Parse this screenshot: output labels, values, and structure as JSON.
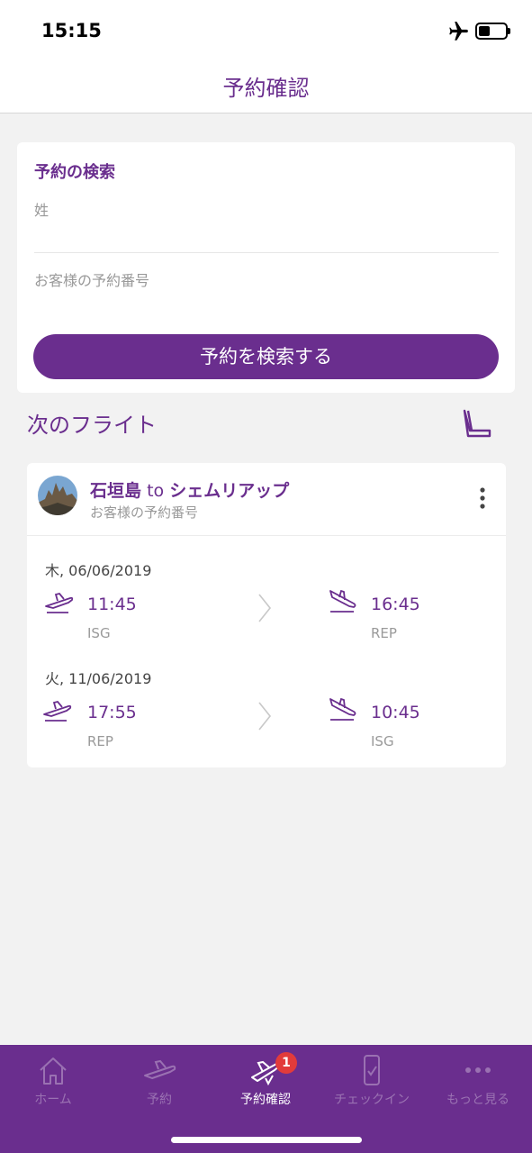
{
  "status": {
    "time": "15:15"
  },
  "nav": {
    "title": "予約確認"
  },
  "search": {
    "title": "予約の検索",
    "last_name_placeholder": "姓",
    "booking_number_placeholder": "お客様の予約番号",
    "button_label": "予約を検索する"
  },
  "upcoming": {
    "title": "次のフライト",
    "card": {
      "origin": "石垣島",
      "connector": "to",
      "destination": "シェムリアップ",
      "booking_label": "お客様の予約番号",
      "legs": [
        {
          "date": "木, 06/06/2019",
          "depart_time": "11:45",
          "depart_code": "ISG",
          "arrive_time": "16:45",
          "arrive_code": "REP"
        },
        {
          "date": "火, 11/06/2019",
          "depart_time": "17:55",
          "depart_code": "REP",
          "arrive_time": "10:45",
          "arrive_code": "ISG"
        }
      ]
    }
  },
  "tabs": [
    {
      "label": "ホーム",
      "icon": "home-icon",
      "active": false
    },
    {
      "label": "予約",
      "icon": "plane-icon",
      "active": false
    },
    {
      "label": "予約確認",
      "icon": "plane-check-icon",
      "active": true,
      "badge": "1"
    },
    {
      "label": "チェックイン",
      "icon": "phone-check-icon",
      "active": false
    },
    {
      "label": "もっと見る",
      "icon": "more-dots-icon",
      "active": false
    }
  ],
  "colors": {
    "brand": "#6a2e8e",
    "badge": "#e23b3b",
    "background": "#f2f2f2"
  }
}
